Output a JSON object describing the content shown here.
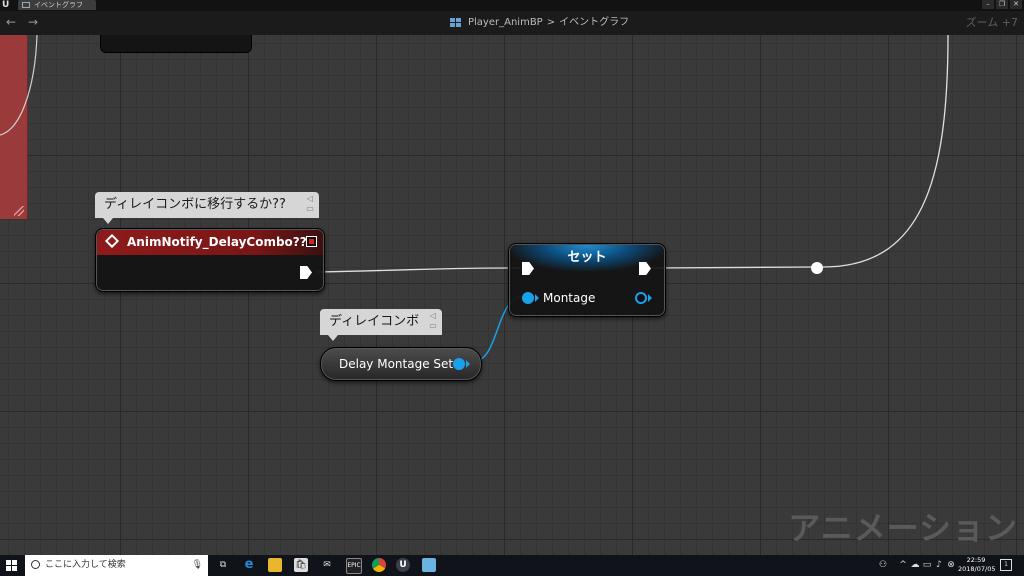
{
  "window": {
    "tab_label": "イベントグラフ",
    "logo_text": "U"
  },
  "toolbar": {
    "back_glyph": "←",
    "forward_glyph": "→",
    "breadcrumb_root": "Player_AnimBP",
    "breadcrumb_separator": ">",
    "breadcrumb_current": "イベントグラフ",
    "zoom": "ズーム +7"
  },
  "comments": {
    "event_comment": "ディレイコンボに移行するか??",
    "variable_comment": "ディレイコンボ"
  },
  "nodes": {
    "event_title": "AnimNotify_DelayCombo??",
    "set_title": "セット",
    "set_pin_label": "Montage",
    "variable_label": "Delay Montage Set"
  },
  "watermark": "アニメーション",
  "taskbar": {
    "search_placeholder": "ここに入力して検索",
    "time": "22:59",
    "date": "2018/07/05",
    "notification_count": "1"
  },
  "colors": {
    "event_header": "#8e1b1b",
    "set_header": "#1e8fd6",
    "object_pin": "#1aa0e8",
    "exec_pin": "#ffffff",
    "comment_bg": "#d6d6d6"
  },
  "icons": {
    "event": "diamond-event-icon",
    "delegate": "delegate-pin-icon",
    "pin": "pin-icon",
    "search": "search-icon",
    "mic": "microphone-icon",
    "task_view": "task-view-icon",
    "edge": "edge-browser-icon",
    "explorer": "file-explorer-icon",
    "store": "store-icon",
    "mail": "mail-icon",
    "epic": "epic-launcher-icon",
    "chrome": "chrome-icon",
    "unreal": "unreal-engine-icon",
    "app": "app-icon"
  }
}
